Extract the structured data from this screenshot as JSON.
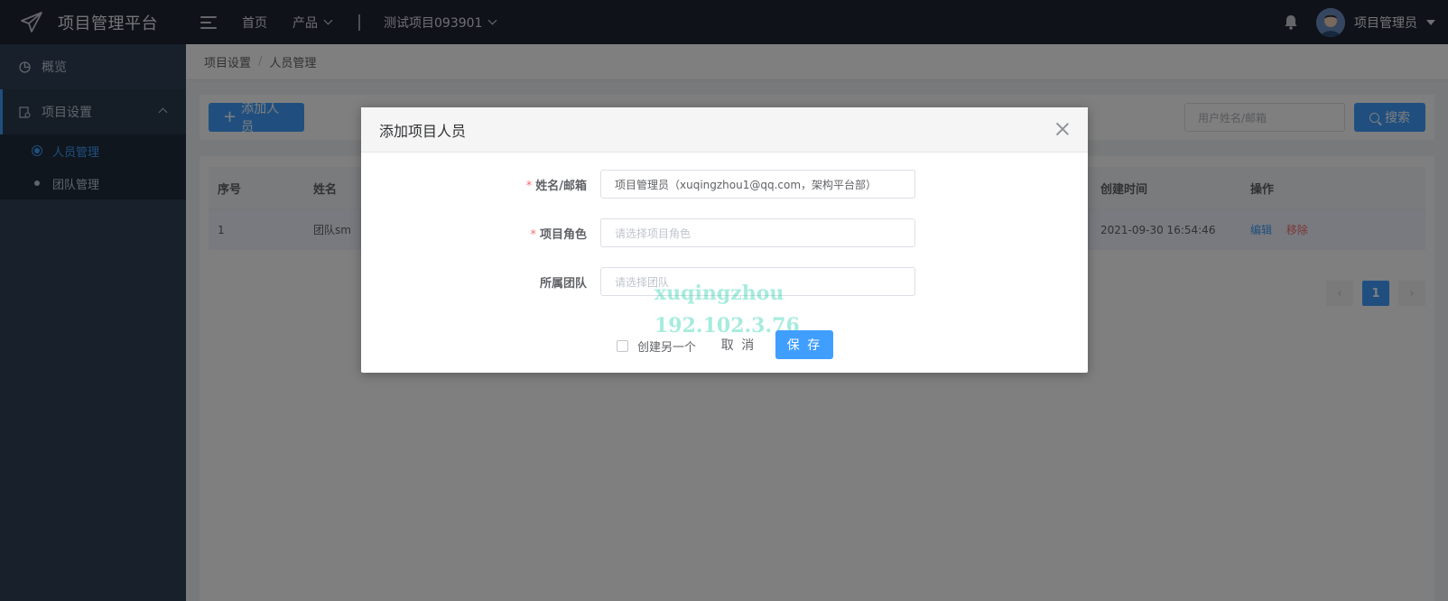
{
  "app": {
    "title": "项目管理平台",
    "nav": {
      "home": "首页",
      "product": "产品",
      "project": "测试项目093901"
    },
    "user": {
      "name": "项目管理员"
    }
  },
  "sidebar": {
    "items": [
      {
        "label": "概览"
      },
      {
        "label": "项目设置",
        "children": [
          {
            "label": "人员管理"
          },
          {
            "label": "团队管理"
          }
        ]
      }
    ]
  },
  "breadcrumb": [
    "项目设置",
    "人员管理"
  ],
  "toolbar": {
    "add_label": "添加人员",
    "search": {
      "placeholder": "用户姓名/邮箱",
      "button_label": "搜索"
    }
  },
  "table": {
    "columns": {
      "index": "序号",
      "name": "姓名",
      "created": "创建时间",
      "actions": "操作"
    },
    "rows": [
      {
        "index": "1",
        "name": "团队sm",
        "created": "2021-09-30 16:54:46",
        "edit": "编辑",
        "remove": "移除"
      }
    ]
  },
  "pagination": {
    "current": "1"
  },
  "modal": {
    "title": "添加项目人员",
    "fields": [
      {
        "label": "姓名/邮箱",
        "required": true,
        "value": "项目管理员（xuqingzhou1@qq.com，架构平台部）",
        "placeholder": ""
      },
      {
        "label": "项目角色",
        "required": true,
        "value": "",
        "placeholder": "请选择项目角色"
      },
      {
        "label": "所属团队",
        "required": false,
        "value": "",
        "placeholder": "请选择团队"
      }
    ],
    "create_another": "创建另一个",
    "cancel": "取 消",
    "save": "保 存"
  },
  "watermark": {
    "line1": "xuqingzhou",
    "line2": "192.102.3.76"
  },
  "colors": {
    "primary": "#409eff",
    "danger": "#f56c6c",
    "topbar": "#1f2532",
    "sidebar": "#304156"
  }
}
